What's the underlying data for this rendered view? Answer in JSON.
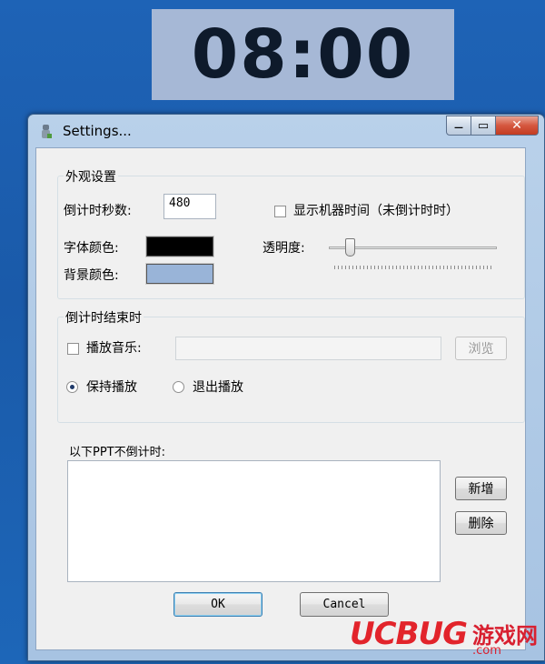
{
  "timer": {
    "display": "08:00"
  },
  "window": {
    "title": "Settings...",
    "min_glyph": "—",
    "max_glyph": "▭",
    "close_glyph": "✕"
  },
  "appearance": {
    "group_label": "外观设置",
    "seconds_label": "倒计时秒数:",
    "seconds_value": "480",
    "show_time_label": "显示机器时间（未倒计时时）",
    "show_time_checked": false,
    "font_color_label": "字体颜色:",
    "font_color": "#000000",
    "bg_color_label": "背景颜色:",
    "bg_color": "#99b4d8",
    "opacity_label": "透明度:",
    "opacity_fraction": 0.12
  },
  "on_end": {
    "group_label": "倒计时结束时",
    "play_music_label": "播放音乐:",
    "play_music_checked": false,
    "music_path": "",
    "browse_label": "浏览",
    "keep_playing_label": "保持播放",
    "keep_playing_selected": true,
    "exit_play_label": "退出播放",
    "exit_play_selected": false
  },
  "exclusions": {
    "label": "以下PPT不倒计时:",
    "add_label": "新增",
    "delete_label": "删除"
  },
  "footer": {
    "ok_label": "OK",
    "cancel_label": "Cancel"
  },
  "watermark": {
    "main": "UCBUG",
    "cn": "游戏网",
    "domain": ".com"
  }
}
